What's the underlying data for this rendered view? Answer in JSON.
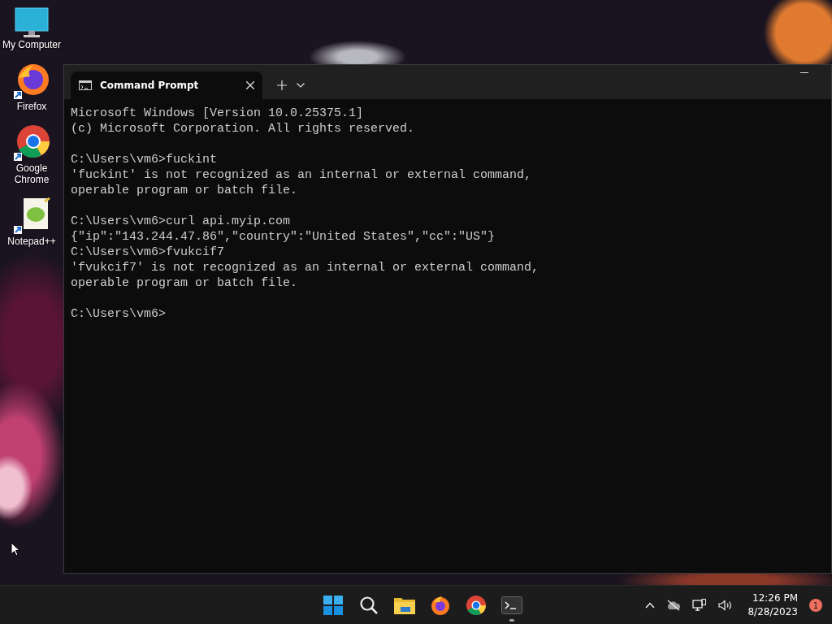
{
  "desktop_icons": [
    {
      "kind": "computer",
      "label": "My Computer"
    },
    {
      "kind": "firefox",
      "label": "Firefox"
    },
    {
      "kind": "chrome",
      "label": "Google Chrome"
    },
    {
      "kind": "notepad",
      "label": "Notepad++"
    }
  ],
  "window": {
    "tabs": [
      {
        "title": "Command Prompt",
        "selected": true
      }
    ],
    "blocks": [
      [
        "Microsoft Windows [Version 10.0.25375.1]",
        "(c) Microsoft Corporation. All rights reserved."
      ],
      [
        "C:\\Users\\vm6>fuckint",
        "'fuckint' is not recognized as an internal or external command,",
        "operable program or batch file."
      ],
      [
        "C:\\Users\\vm6>curl api.myip.com",
        "{\"ip\":\"143.244.47.86\",\"country\":\"United States\",\"cc\":\"US\"}",
        "C:\\Users\\vm6>fvukcif7",
        "'fvukcif7' is not recognized as an internal or external command,",
        "operable program or batch file."
      ],
      [
        "C:\\Users\\vm6>"
      ]
    ]
  },
  "taskbar": {
    "apps": [
      {
        "kind": "start",
        "running": false
      },
      {
        "kind": "search",
        "running": false
      },
      {
        "kind": "explorer",
        "running": false
      },
      {
        "kind": "firefox",
        "running": false
      },
      {
        "kind": "chrome",
        "running": false
      },
      {
        "kind": "terminal",
        "running": true
      }
    ],
    "time": "12:26 PM",
    "date": "8/28/2023",
    "notifications": "1"
  }
}
